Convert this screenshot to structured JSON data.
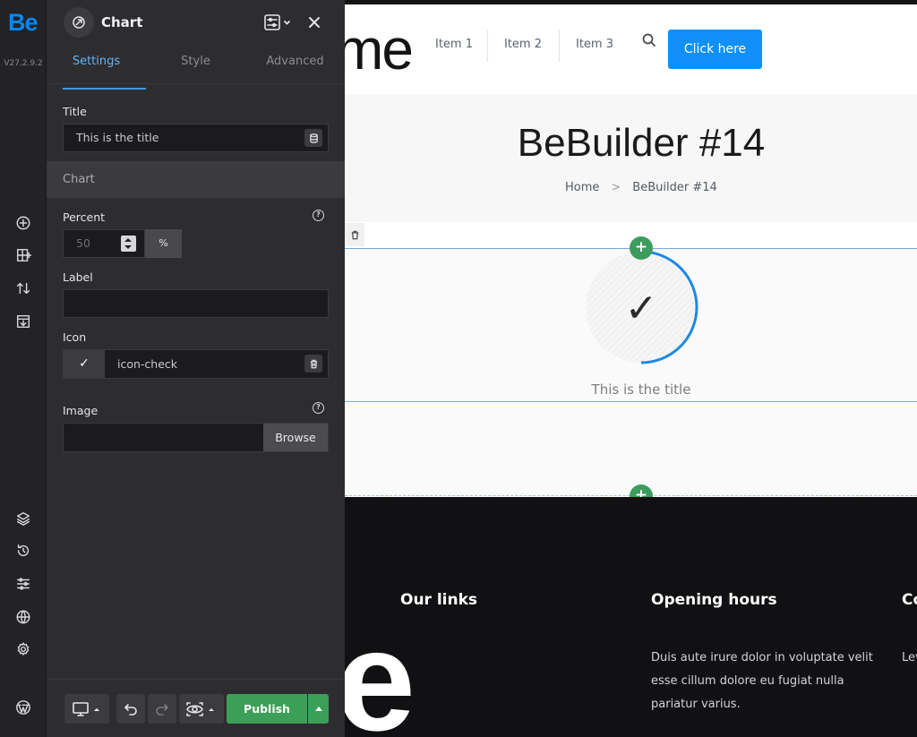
{
  "app": {
    "logo": "Be",
    "version": "V27.2.9.2"
  },
  "panel": {
    "title": "Chart",
    "tabs": [
      {
        "label": "Settings"
      },
      {
        "label": "Style"
      },
      {
        "label": "Advanced"
      }
    ],
    "title_field": {
      "label": "Title",
      "value": "This is the title"
    },
    "section_label": "Chart",
    "percent_field": {
      "label": "Percent",
      "value": "50",
      "unit": "%"
    },
    "label_field": {
      "label": "Label",
      "value": ""
    },
    "icon_field": {
      "label": "Icon",
      "preview": "✓",
      "value": "icon-check"
    },
    "image_field": {
      "label": "Image",
      "value": "",
      "browse": "Browse"
    },
    "help_glyph": "?",
    "publish_label": "Publish"
  },
  "site": {
    "logo_text": "me",
    "nav": [
      "Item 1",
      "Item 2",
      "Item 3"
    ],
    "cta": "Click here",
    "hero_title": "BeBuilder #14",
    "breadcrumb": {
      "home": "Home",
      "sep": ">",
      "current": "BeBuilder #14"
    },
    "chart": {
      "percent": 50,
      "icon": "✓",
      "caption": "This is the title",
      "accent": "#1e88e5"
    },
    "add_glyph": "+",
    "footer": {
      "big_letter": "e",
      "links_heading": "Our links",
      "hours_heading": "Opening hours",
      "third_heading": "Co",
      "hours_text": "Duis aute irure dolor in voluptate velit esse cillum dolore eu fugiat nulla pariatur varius.",
      "third_text": "Lev Me Au"
    }
  }
}
